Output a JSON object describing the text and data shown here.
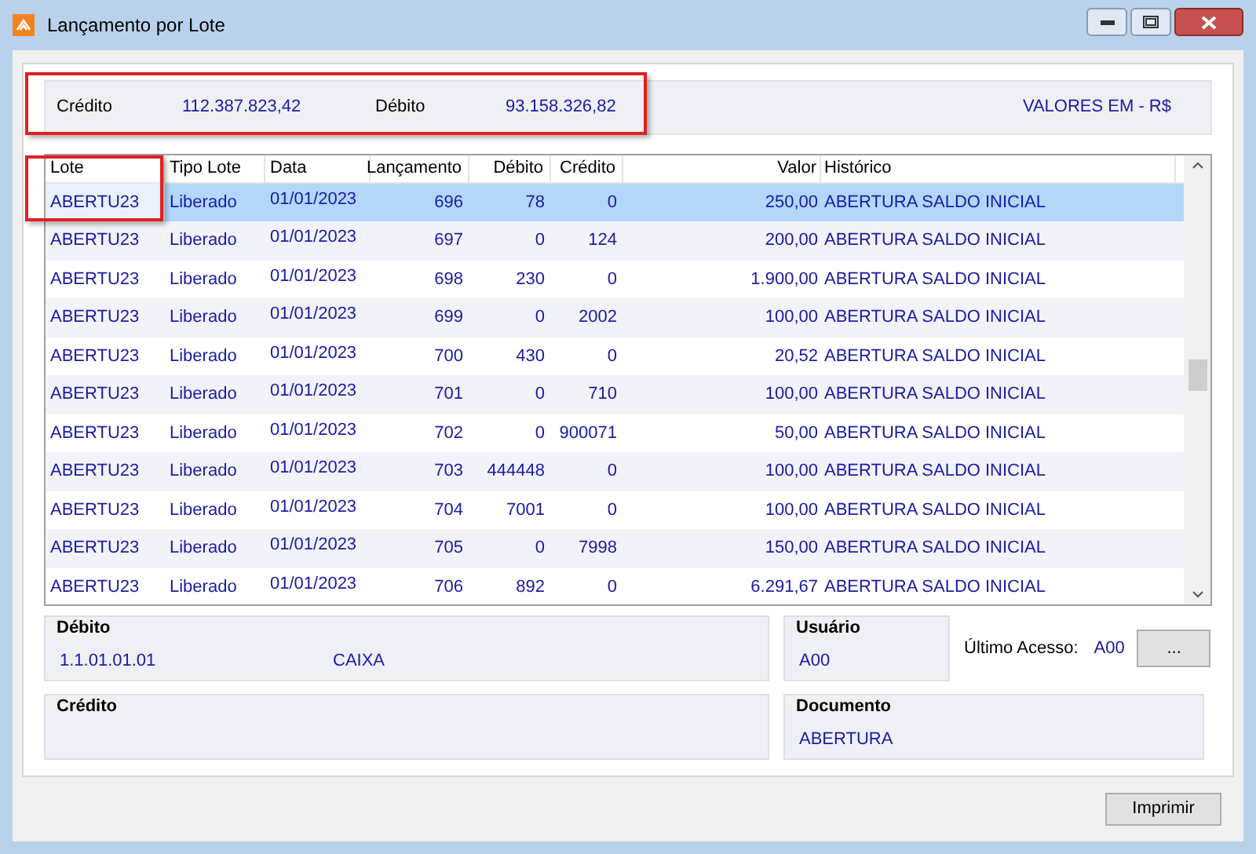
{
  "window": {
    "title": "Lançamento por Lote"
  },
  "summary": {
    "credito_label": "Crédito",
    "credito": "112.387.823,42",
    "debito_label": "Débito",
    "debito": "93.158.326,82",
    "currency": "VALORES EM - R$"
  },
  "table": {
    "columns": [
      "Lote",
      "Tipo Lote",
      "Data",
      "Lançamento",
      "Débito",
      "Crédito",
      "Valor",
      "Histórico"
    ],
    "rows": [
      {
        "selected": true,
        "cells": [
          "ABERTU23",
          "Liberado",
          "01/01/2023",
          "696",
          "78",
          "0",
          "250,00",
          "ABERTURA SALDO INICIAL"
        ]
      },
      {
        "selected": false,
        "cells": [
          "ABERTU23",
          "Liberado",
          "01/01/2023",
          "697",
          "0",
          "124",
          "200,00",
          "ABERTURA SALDO INICIAL"
        ]
      },
      {
        "selected": false,
        "cells": [
          "ABERTU23",
          "Liberado",
          "01/01/2023",
          "698",
          "230",
          "0",
          "1.900,00",
          "ABERTURA SALDO INICIAL"
        ]
      },
      {
        "selected": false,
        "cells": [
          "ABERTU23",
          "Liberado",
          "01/01/2023",
          "699",
          "0",
          "2002",
          "100,00",
          "ABERTURA SALDO INICIAL"
        ]
      },
      {
        "selected": false,
        "cells": [
          "ABERTU23",
          "Liberado",
          "01/01/2023",
          "700",
          "430",
          "0",
          "20,52",
          "ABERTURA SALDO INICIAL"
        ]
      },
      {
        "selected": false,
        "cells": [
          "ABERTU23",
          "Liberado",
          "01/01/2023",
          "701",
          "0",
          "710",
          "100,00",
          "ABERTURA SALDO INICIAL"
        ]
      },
      {
        "selected": false,
        "cells": [
          "ABERTU23",
          "Liberado",
          "01/01/2023",
          "702",
          "0",
          "900071",
          "50,00",
          "ABERTURA SALDO INICIAL"
        ]
      },
      {
        "selected": false,
        "cells": [
          "ABERTU23",
          "Liberado",
          "01/01/2023",
          "703",
          "444448",
          "0",
          "100,00",
          "ABERTURA SALDO INICIAL"
        ]
      },
      {
        "selected": false,
        "cells": [
          "ABERTU23",
          "Liberado",
          "01/01/2023",
          "704",
          "7001",
          "0",
          "100,00",
          "ABERTURA SALDO INICIAL"
        ]
      },
      {
        "selected": false,
        "cells": [
          "ABERTU23",
          "Liberado",
          "01/01/2023",
          "705",
          "0",
          "7998",
          "150,00",
          "ABERTURA SALDO INICIAL"
        ]
      },
      {
        "selected": false,
        "cells": [
          "ABERTU23",
          "Liberado",
          "01/01/2023",
          "706",
          "892",
          "0",
          "6.291,67",
          "ABERTURA SALDO INICIAL"
        ]
      }
    ]
  },
  "debito_group": {
    "title": "Débito",
    "account": "1.1.01.01.01",
    "name": "CAIXA"
  },
  "usuario_group": {
    "title": "Usuário",
    "value": "A00"
  },
  "ultimo_acesso": {
    "label": "Último Acesso:",
    "value": "A00",
    "button": "..."
  },
  "credito_group": {
    "title": "Crédito"
  },
  "documento_group": {
    "title": "Documento",
    "value": "ABERTURA"
  },
  "print_button": "Imprimir"
}
